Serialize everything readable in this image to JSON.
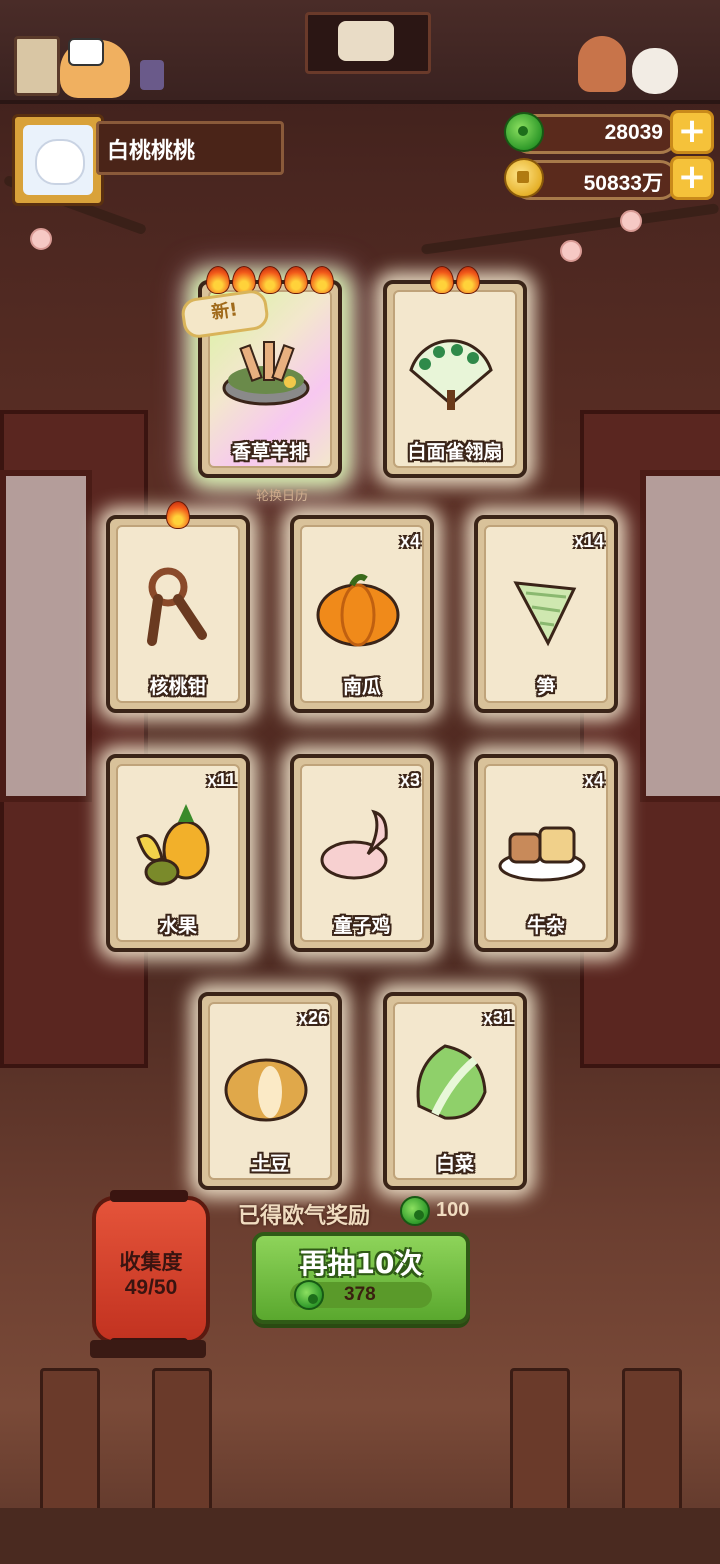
{
  "player": {
    "name": "白桃桃桃"
  },
  "currency": {
    "jade": "28039",
    "coins": "50833万"
  },
  "new_badge": "新!",
  "featured_cards": [
    {
      "label": "香草羊排",
      "rarity_flames": 5,
      "new": true,
      "icon": "lamb-chops-icon"
    },
    {
      "label": "白面雀翎扇",
      "rarity_flames": 2,
      "new": false,
      "icon": "peacock-fan-icon"
    }
  ],
  "calendar_label": "轮换日历",
  "cards": [
    {
      "label": "核桃钳",
      "count": "",
      "flames": 1,
      "icon": "walnut-cracker-icon"
    },
    {
      "label": "南瓜",
      "count": "x4",
      "flames": 0,
      "icon": "pumpkin-icon"
    },
    {
      "label": "笋",
      "count": "x14",
      "flames": 0,
      "icon": "bamboo-shoot-icon"
    },
    {
      "label": "水果",
      "count": "x11",
      "flames": 0,
      "icon": "fruit-icon"
    },
    {
      "label": "童子鸡",
      "count": "x3",
      "flames": 0,
      "icon": "chicken-icon"
    },
    {
      "label": "牛杂",
      "count": "x4",
      "flames": 0,
      "icon": "beef-offal-icon"
    },
    {
      "label": "土豆",
      "count": "x26",
      "flames": 0,
      "icon": "potato-icon"
    },
    {
      "label": "白菜",
      "count": "x31",
      "flames": 0,
      "icon": "cabbage-icon"
    }
  ],
  "collection": {
    "title": "收集度",
    "progress": "49/50"
  },
  "reward": {
    "text": "已得欧气奖励",
    "value": "100"
  },
  "draw_button": {
    "label": "再抽10次",
    "cost": "378"
  },
  "colors": {
    "draw_green": "#6cbf3a",
    "jade": "#2f9a2a",
    "coin": "#e6b12a",
    "lantern": "#d2422c"
  }
}
